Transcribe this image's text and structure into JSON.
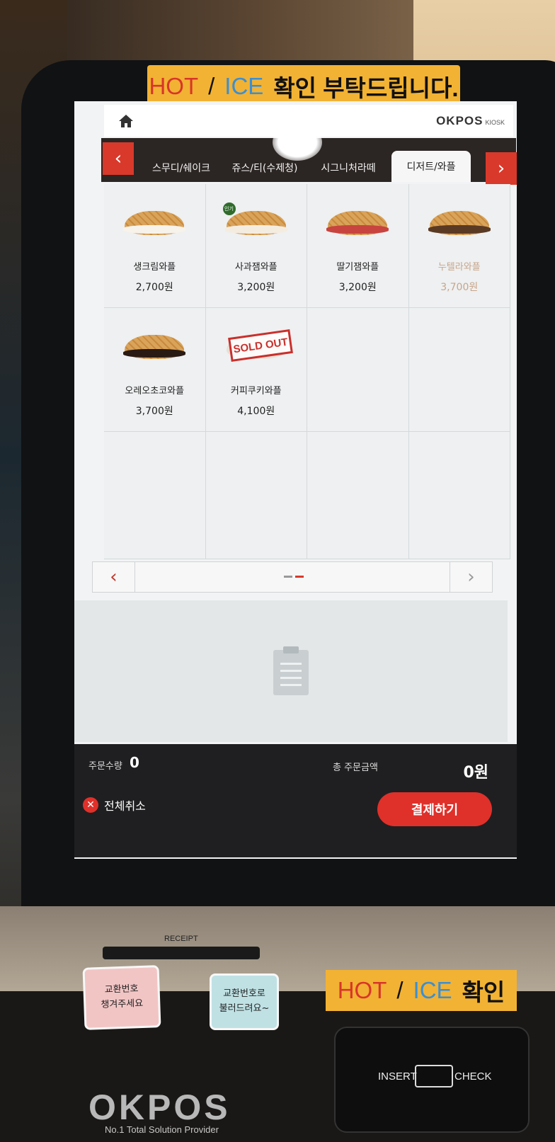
{
  "stickers": {
    "top": {
      "hot": "HOT",
      "slash": "/",
      "ice": "ICE",
      "rest": "확인 부탁드립니다."
    },
    "bottom": {
      "hot": "HOT",
      "slash": "/",
      "ice": "ICE",
      "rest": "확인"
    }
  },
  "header": {
    "brand": "OKPOS",
    "brand_sub": "KIOSK"
  },
  "tabs": [
    {
      "label": "스무디/쉐이크",
      "active": false
    },
    {
      "label": "쥬스/티(수제청)",
      "active": false
    },
    {
      "label": "시그니처라떼",
      "active": false
    },
    {
      "label": "디저트/와플",
      "active": true
    }
  ],
  "nav": {
    "prev": "‹",
    "next": "›"
  },
  "products": [
    {
      "name": "생크림와플",
      "price": "2,700원",
      "filling": "#f7f2ea"
    },
    {
      "name": "사과잼와플",
      "price": "3,200원",
      "filling": "#f5ece0",
      "badge": "인기"
    },
    {
      "name": "딸기잼와플",
      "price": "3,200원",
      "filling": "#c8443f"
    },
    {
      "name": "누텔라와플",
      "price": "3,700원",
      "filling": "#5b3a24",
      "dim": true
    },
    {
      "name": "오레오초코와플",
      "price": "3,700원",
      "filling": "#2a1a14"
    },
    {
      "name": "커피쿠키와플",
      "price": "4,100원",
      "sold_out": "SOLD OUT"
    }
  ],
  "footer": {
    "qty_label": "주문수량",
    "qty_value": "0",
    "total_label": "총 주문금액",
    "total_value": "0원",
    "cancel_label": "전체취소",
    "pay_label": "결제하기"
  },
  "hardware": {
    "receipt_label": "RECEIPT",
    "note1": "교환번호\n챙겨주세요",
    "note2": "교환번호로\n불러드려요~",
    "insert_label": "INSERT",
    "check_label": "CHECK",
    "logo": "OKPOS",
    "tagline": "No.1 Total Solution Provider"
  },
  "colors": {
    "accent": "#d9392b",
    "tab_bar": "#2b2523",
    "pay_button": "#e0302a"
  }
}
